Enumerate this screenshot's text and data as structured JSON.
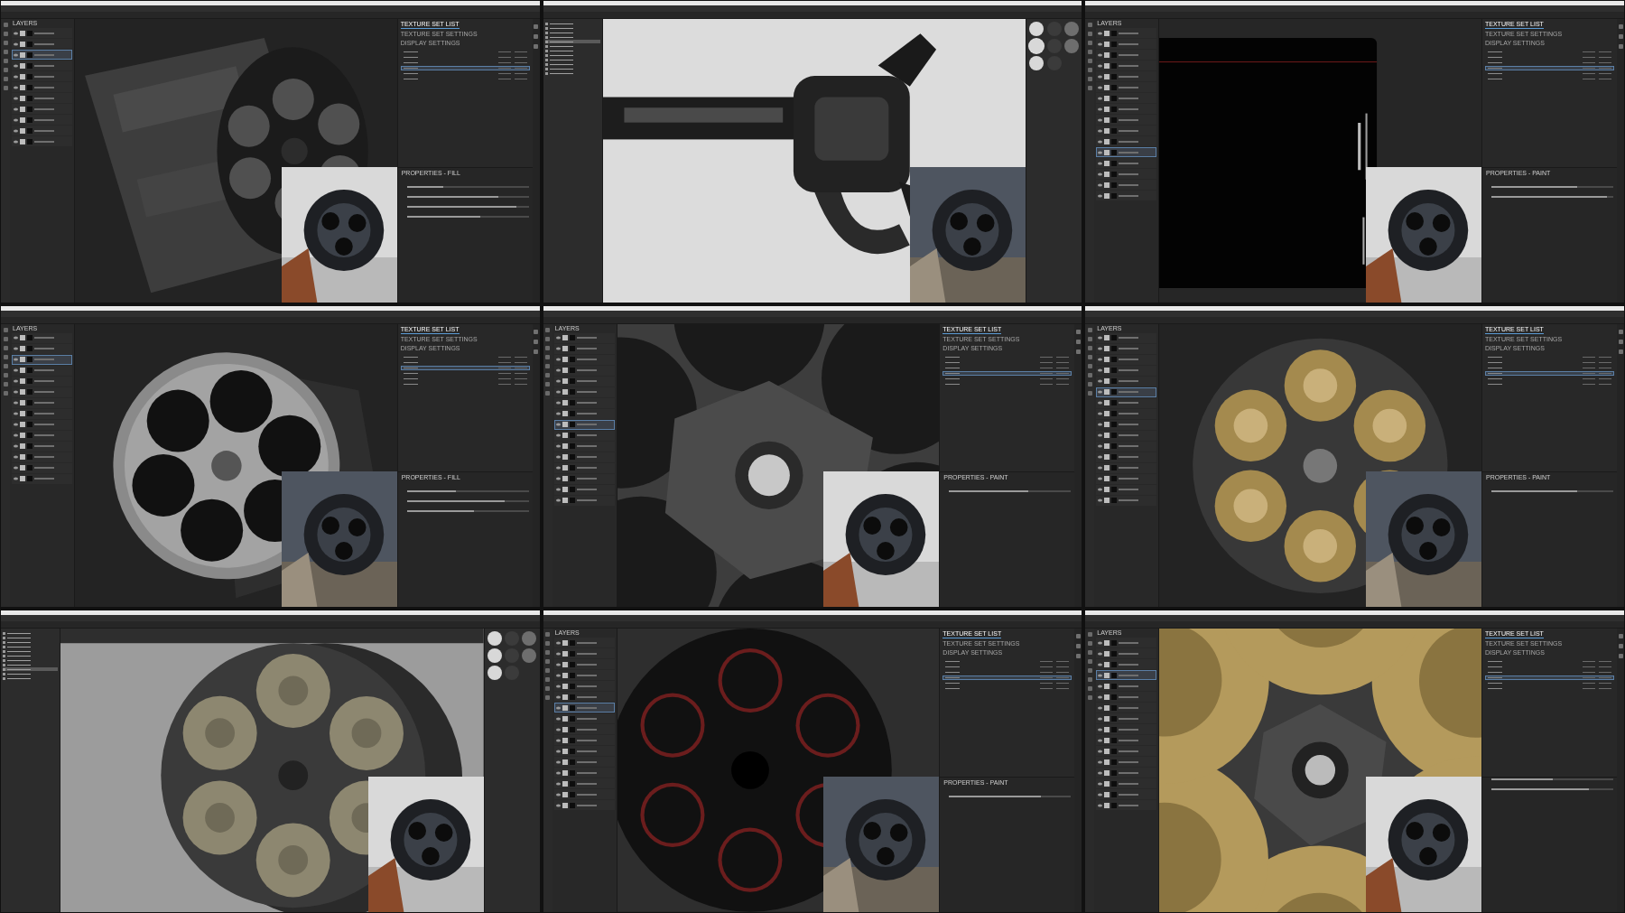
{
  "tiles": [
    {
      "kind": "painter",
      "layer_title": "LAYERS",
      "tabs": [
        {
          "label": "TEXTURE SET LIST",
          "selected": true
        },
        {
          "label": "TEXTURE SET SETTINGS",
          "selected": false
        },
        {
          "label": "DISPLAY SETTINGS",
          "selected": false
        }
      ],
      "texture_sets": [
        {
          "selected": false
        },
        {
          "selected": false
        },
        {
          "selected": false
        },
        {
          "selected": true
        },
        {
          "selected": false
        },
        {
          "selected": false
        }
      ],
      "layers": [
        {
          "selected": false
        },
        {
          "selected": false
        },
        {
          "selected": true
        },
        {
          "selected": false
        },
        {
          "selected": false
        },
        {
          "selected": false
        },
        {
          "selected": false
        },
        {
          "selected": false
        },
        {
          "selected": false
        },
        {
          "selected": false
        },
        {
          "selected": false
        }
      ],
      "properties_title": "PROPERTIES - FILL",
      "sliders": [
        {
          "level": 0.3
        },
        {
          "level": 0.75
        },
        {
          "level": 0.9
        },
        {
          "level": 0.6
        }
      ]
    },
    {
      "kind": "other",
      "tree": [
        {
          "selected": false
        },
        {
          "selected": false
        },
        {
          "selected": false
        },
        {
          "selected": false
        },
        {
          "selected": true
        },
        {
          "selected": false
        },
        {
          "selected": false
        },
        {
          "selected": false
        },
        {
          "selected": false
        },
        {
          "selected": false
        },
        {
          "selected": false
        },
        {
          "selected": false
        }
      ],
      "materials": [
        {
          "selected": false
        },
        {
          "selected": false
        },
        {
          "selected": false
        },
        {
          "selected": true
        },
        {
          "selected": false
        },
        {
          "selected": false
        },
        {
          "selected": false
        },
        {
          "selected": false
        }
      ]
    },
    {
      "kind": "painter",
      "layer_title": "LAYERS",
      "tabs": [
        {
          "label": "TEXTURE SET LIST",
          "selected": true
        },
        {
          "label": "TEXTURE SET SETTINGS",
          "selected": false
        },
        {
          "label": "DISPLAY SETTINGS",
          "selected": false
        }
      ],
      "texture_sets": [
        {
          "selected": false
        },
        {
          "selected": false
        },
        {
          "selected": false
        },
        {
          "selected": true
        },
        {
          "selected": false
        },
        {
          "selected": false
        }
      ],
      "layers": [
        {
          "selected": false
        },
        {
          "selected": false
        },
        {
          "selected": false
        },
        {
          "selected": false
        },
        {
          "selected": false
        },
        {
          "selected": false
        },
        {
          "selected": false
        },
        {
          "selected": false
        },
        {
          "selected": false
        },
        {
          "selected": false
        },
        {
          "selected": false
        },
        {
          "selected": true
        },
        {
          "selected": false
        },
        {
          "selected": false
        },
        {
          "selected": false
        },
        {
          "selected": false
        }
      ],
      "properties_title": "PROPERTIES - PAINT",
      "sliders": [
        {
          "level": 0.7
        },
        {
          "level": 0.95
        }
      ]
    },
    {
      "kind": "painter",
      "layer_title": "LAYERS",
      "tabs": [
        {
          "label": "TEXTURE SET LIST",
          "selected": true
        },
        {
          "label": "TEXTURE SET SETTINGS",
          "selected": false
        },
        {
          "label": "DISPLAY SETTINGS",
          "selected": false
        }
      ],
      "texture_sets": [
        {
          "selected": false
        },
        {
          "selected": false
        },
        {
          "selected": true
        },
        {
          "selected": false
        },
        {
          "selected": false
        },
        {
          "selected": false
        }
      ],
      "layers": [
        {
          "selected": false
        },
        {
          "selected": false
        },
        {
          "selected": true
        },
        {
          "selected": false
        },
        {
          "selected": false
        },
        {
          "selected": false
        },
        {
          "selected": false
        },
        {
          "selected": false
        },
        {
          "selected": false
        },
        {
          "selected": false
        },
        {
          "selected": false
        },
        {
          "selected": false
        },
        {
          "selected": false
        },
        {
          "selected": false
        }
      ],
      "properties_title": "PROPERTIES - FILL",
      "sliders": [
        {
          "level": 0.4
        },
        {
          "level": 0.8
        },
        {
          "level": 0.55
        }
      ]
    },
    {
      "kind": "painter",
      "layer_title": "LAYERS",
      "tabs": [
        {
          "label": "TEXTURE SET LIST",
          "selected": true
        },
        {
          "label": "TEXTURE SET SETTINGS",
          "selected": false
        },
        {
          "label": "DISPLAY SETTINGS",
          "selected": false
        }
      ],
      "texture_sets": [
        {
          "selected": false
        },
        {
          "selected": false
        },
        {
          "selected": false
        },
        {
          "selected": true
        },
        {
          "selected": false
        },
        {
          "selected": false
        }
      ],
      "layers": [
        {
          "selected": false
        },
        {
          "selected": false
        },
        {
          "selected": false
        },
        {
          "selected": false
        },
        {
          "selected": false
        },
        {
          "selected": false
        },
        {
          "selected": false
        },
        {
          "selected": false
        },
        {
          "selected": true
        },
        {
          "selected": false
        },
        {
          "selected": false
        },
        {
          "selected": false
        },
        {
          "selected": false
        },
        {
          "selected": false
        },
        {
          "selected": false
        },
        {
          "selected": false
        }
      ],
      "properties_title": "PROPERTIES - PAINT",
      "sliders": [
        {
          "level": 0.65
        }
      ]
    },
    {
      "kind": "painter",
      "layer_title": "LAYERS",
      "tabs": [
        {
          "label": "TEXTURE SET LIST",
          "selected": true
        },
        {
          "label": "TEXTURE SET SETTINGS",
          "selected": false
        },
        {
          "label": "DISPLAY SETTINGS",
          "selected": false
        }
      ],
      "texture_sets": [
        {
          "selected": false
        },
        {
          "selected": false
        },
        {
          "selected": false
        },
        {
          "selected": true
        },
        {
          "selected": false
        },
        {
          "selected": false
        }
      ],
      "layers": [
        {
          "selected": false
        },
        {
          "selected": false
        },
        {
          "selected": false
        },
        {
          "selected": false
        },
        {
          "selected": false
        },
        {
          "selected": true
        },
        {
          "selected": false
        },
        {
          "selected": false
        },
        {
          "selected": false
        },
        {
          "selected": false
        },
        {
          "selected": false
        },
        {
          "selected": false
        },
        {
          "selected": false
        },
        {
          "selected": false
        },
        {
          "selected": false
        },
        {
          "selected": false
        }
      ],
      "properties_title": "PROPERTIES - PAINT",
      "sliders": [
        {
          "level": 0.7
        }
      ]
    },
    {
      "kind": "other",
      "tree": [
        {
          "selected": false
        },
        {
          "selected": false
        },
        {
          "selected": false
        },
        {
          "selected": false
        },
        {
          "selected": false
        },
        {
          "selected": false
        },
        {
          "selected": false
        },
        {
          "selected": false
        },
        {
          "selected": true
        },
        {
          "selected": false
        },
        {
          "selected": false
        }
      ],
      "materials": [
        {
          "selected": false
        },
        {
          "selected": false
        },
        {
          "selected": false
        },
        {
          "selected": false
        },
        {
          "selected": false
        },
        {
          "selected": false
        },
        {
          "selected": false
        },
        {
          "selected": false
        }
      ]
    },
    {
      "kind": "painter",
      "layer_title": "LAYERS",
      "tabs": [
        {
          "label": "TEXTURE SET LIST",
          "selected": true
        },
        {
          "label": "TEXTURE SET SETTINGS",
          "selected": false
        },
        {
          "label": "DISPLAY SETTINGS",
          "selected": false
        }
      ],
      "texture_sets": [
        {
          "selected": false
        },
        {
          "selected": false
        },
        {
          "selected": false
        },
        {
          "selected": true
        },
        {
          "selected": false
        },
        {
          "selected": false
        }
      ],
      "layers": [
        {
          "selected": false
        },
        {
          "selected": false
        },
        {
          "selected": false
        },
        {
          "selected": false
        },
        {
          "selected": false
        },
        {
          "selected": false
        },
        {
          "selected": true
        },
        {
          "selected": false
        },
        {
          "selected": false
        },
        {
          "selected": false
        },
        {
          "selected": false
        },
        {
          "selected": false
        },
        {
          "selected": false
        },
        {
          "selected": false
        },
        {
          "selected": false
        },
        {
          "selected": false
        }
      ],
      "properties_title": "PROPERTIES - PAINT",
      "sliders": [
        {
          "level": 0.75
        }
      ]
    },
    {
      "kind": "painter",
      "layer_title": "LAYERS",
      "tabs": [
        {
          "label": "TEXTURE SET LIST",
          "selected": true
        },
        {
          "label": "TEXTURE SET SETTINGS",
          "selected": false
        },
        {
          "label": "DISPLAY SETTINGS",
          "selected": false
        }
      ],
      "texture_sets": [
        {
          "selected": false
        },
        {
          "selected": false
        },
        {
          "selected": false
        },
        {
          "selected": true
        },
        {
          "selected": false
        },
        {
          "selected": false
        }
      ],
      "layers": [
        {
          "selected": false
        },
        {
          "selected": false
        },
        {
          "selected": false
        },
        {
          "selected": true
        },
        {
          "selected": false
        },
        {
          "selected": false
        },
        {
          "selected": false
        },
        {
          "selected": false
        },
        {
          "selected": false
        },
        {
          "selected": false
        },
        {
          "selected": false
        },
        {
          "selected": false
        },
        {
          "selected": false
        },
        {
          "selected": false
        },
        {
          "selected": false
        },
        {
          "selected": false
        }
      ],
      "sliders": [
        {
          "level": 0.5
        },
        {
          "level": 0.8
        }
      ]
    }
  ]
}
